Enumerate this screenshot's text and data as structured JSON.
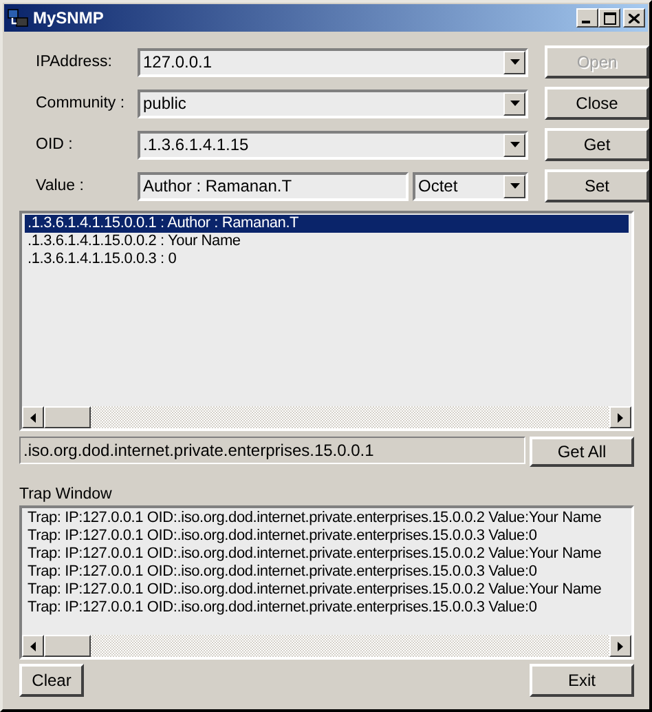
{
  "window": {
    "title": "MySNMP"
  },
  "fields": [
    {
      "label": "IPAddress:",
      "value": "127.0.0.1",
      "kind": "combo"
    },
    {
      "label": "Community :",
      "value": "public",
      "kind": "combo"
    },
    {
      "label": "OID :",
      "value": ".1.3.6.1.4.1.15",
      "kind": "combo"
    },
    {
      "label": "Value :",
      "value": "Author : Ramanan.T",
      "kind": "text",
      "type_value": "Octet"
    }
  ],
  "side_buttons": [
    {
      "label": "Open",
      "disabled": true
    },
    {
      "label": "Close",
      "disabled": false
    },
    {
      "label": "Get",
      "disabled": false
    },
    {
      "label": "Set",
      "disabled": false
    }
  ],
  "results": [
    {
      "text": ".1.3.6.1.4.1.15.0.0.1 : Author : Ramanan.T",
      "selected": true
    },
    {
      "text": ".1.3.6.1.4.1.15.0.0.2 : Your Name",
      "selected": false
    },
    {
      "text": ".1.3.6.1.4.1.15.0.0.3 : 0",
      "selected": false
    }
  ],
  "status": ".iso.org.dod.internet.private.enterprises.15.0.0.1",
  "get_all_button": "Get All",
  "trap_window": {
    "label": "Trap Window",
    "lines": [
      "Trap: IP:127.0.0.1 OID:.iso.org.dod.internet.private.enterprises.15.0.0.2 Value:Your Name",
      "Trap: IP:127.0.0.1 OID:.iso.org.dod.internet.private.enterprises.15.0.0.3 Value:0",
      "Trap: IP:127.0.0.1 OID:.iso.org.dod.internet.private.enterprises.15.0.0.2 Value:Your Name",
      "Trap: IP:127.0.0.1 OID:.iso.org.dod.internet.private.enterprises.15.0.0.3 Value:0",
      "Trap: IP:127.0.0.1 OID:.iso.org.dod.internet.private.enterprises.15.0.0.2 Value:Your Name",
      "Trap: IP:127.0.0.1 OID:.iso.org.dod.internet.private.enterprises.15.0.0.3 Value:0"
    ]
  },
  "bottom_buttons": [
    "Clear",
    "Exit"
  ]
}
